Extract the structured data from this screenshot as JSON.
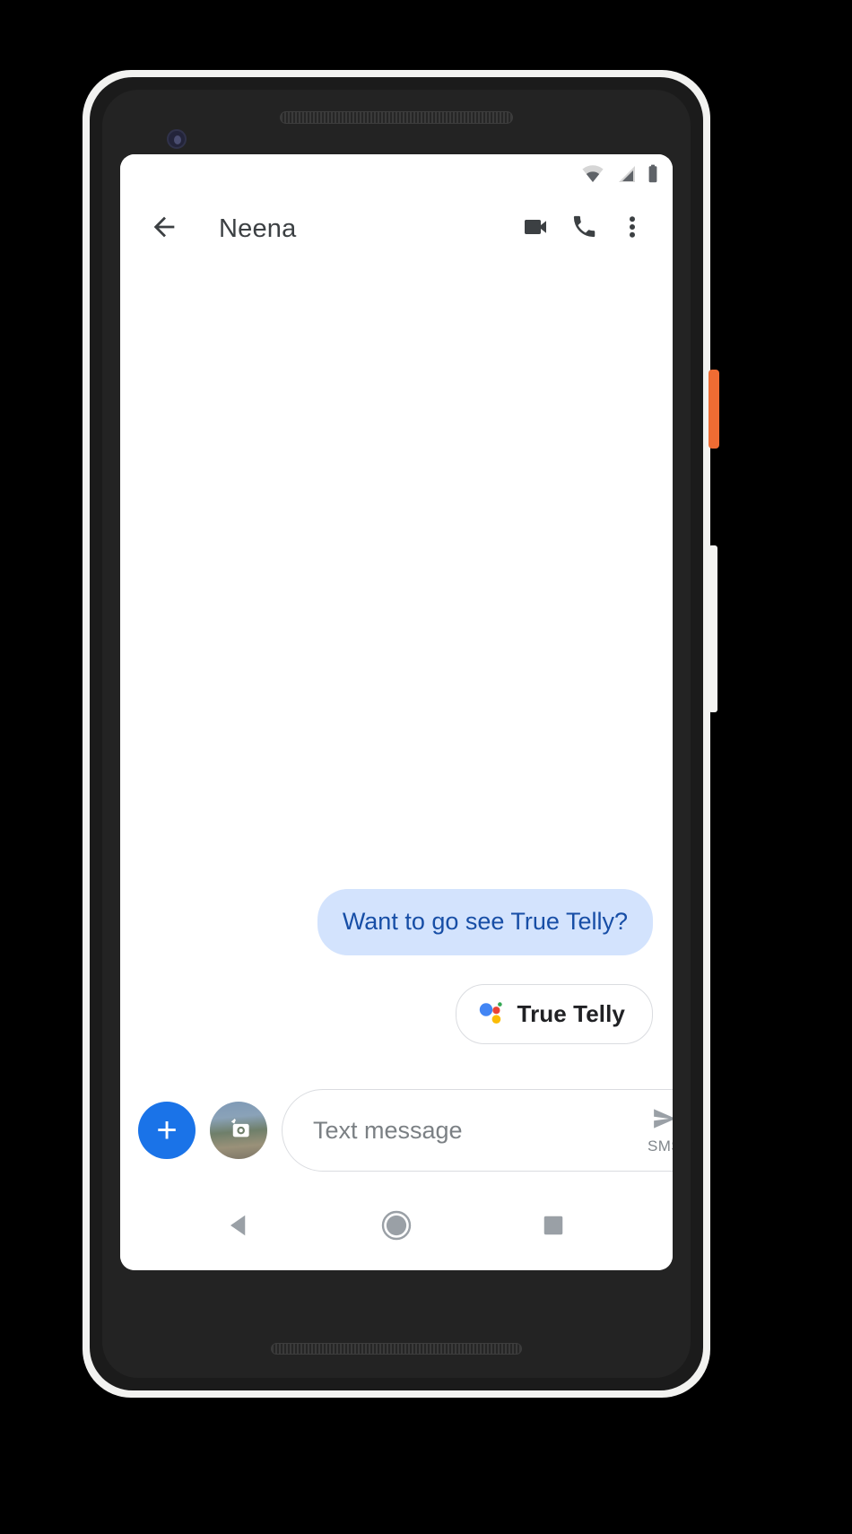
{
  "device": {
    "name": "pixel-phone",
    "frame_color": "#f2f2f0",
    "body_color": "#1b1b1b",
    "power_button_color": "#ef6c33",
    "volume_button_color": "#f4f4f2"
  },
  "status_bar": {
    "wifi_icon": "wifi-icon",
    "signal_icon": "cellular-signal-icon",
    "battery_icon": "battery-full-icon",
    "icon_color": "#5f6368"
  },
  "toolbar": {
    "back_icon": "arrow-back-icon",
    "title": "Neena",
    "video_call_icon": "video-camera-icon",
    "voice_call_icon": "phone-icon",
    "overflow_icon": "more-vertical-icon",
    "icon_color": "#3c4043"
  },
  "thread": {
    "messages": [
      {
        "text": "Want to go see True Telly?",
        "direction": "outgoing",
        "bubble_color": "#d3e3fd",
        "text_color": "#174ea6"
      }
    ],
    "suggestion_chip": {
      "label": "True Telly",
      "icon": "google-assistant-icon",
      "dot_colors": {
        "blue": "#4285f4",
        "red": "#ea4335",
        "yellow": "#fbbc04",
        "green": "#34a853"
      }
    }
  },
  "composer": {
    "attach_label": "+",
    "attach_color": "#1a73e8",
    "camera_icon": "camera-icon",
    "input_value": "",
    "input_placeholder": "Text message",
    "send_icon": "send-icon",
    "send_label": "SMS"
  },
  "nav_bar": {
    "back_icon": "nav-back-triangle-icon",
    "home_icon": "nav-home-circle-icon",
    "recents_icon": "nav-recents-square-icon",
    "icon_color": "#9aa0a6"
  }
}
